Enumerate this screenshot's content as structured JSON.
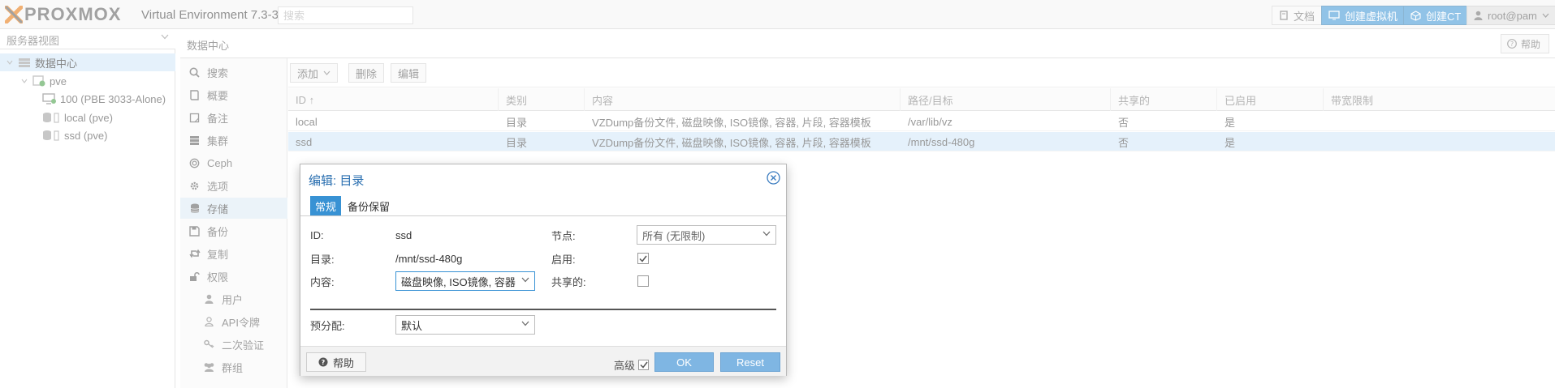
{
  "topbar": {
    "logo_text": "PROXMOX",
    "subtitle": "Virtual Environment 7.3-3",
    "search_placeholder": "搜索",
    "docs_label": "文档",
    "create_vm_label": "创建虚拟机",
    "create_ct_label": "创建CT",
    "user_label": "root@pam"
  },
  "tree": {
    "view_label": "服务器视图",
    "items": [
      {
        "label": "数据中心",
        "icon": "datacenter-icon"
      },
      {
        "label": "pve",
        "icon": "node-icon"
      },
      {
        "label": "100 (PBE 3033-Alone)",
        "icon": "vm-icon"
      },
      {
        "label": "local (pve)",
        "icon": "storage-icon"
      },
      {
        "label": "ssd (pve)",
        "icon": "storage-icon"
      }
    ]
  },
  "main": {
    "title": "数据中心",
    "help_label": "帮助"
  },
  "menu": {
    "items": [
      {
        "label": "搜索",
        "icon": "search-icon"
      },
      {
        "label": "概要",
        "icon": "book-icon"
      },
      {
        "label": "备注",
        "icon": "note-icon"
      },
      {
        "label": "集群",
        "icon": "server-icon"
      },
      {
        "label": "Ceph",
        "icon": "ceph-icon"
      },
      {
        "label": "选项",
        "icon": "gear-icon"
      },
      {
        "label": "存储",
        "icon": "database-icon"
      },
      {
        "label": "备份",
        "icon": "floppy-icon"
      },
      {
        "label": "复制",
        "icon": "retweet-icon"
      },
      {
        "label": "权限",
        "icon": "unlock-icon"
      },
      {
        "label": "用户",
        "icon": "user-icon"
      },
      {
        "label": "API令牌",
        "icon": "user-o-icon"
      },
      {
        "label": "二次验证",
        "icon": "key-icon"
      },
      {
        "label": "群组",
        "icon": "users-icon"
      }
    ]
  },
  "toolbar": {
    "add_label": "添加",
    "delete_label": "删除",
    "edit_label": "编辑"
  },
  "table": {
    "columns": [
      "ID ↑",
      "类别",
      "内容",
      "路径/目标",
      "共享的",
      "已启用",
      "带宽限制"
    ],
    "rows": [
      [
        "local",
        "目录",
        "VZDump备份文件, 磁盘映像, ISO镜像, 容器, 片段, 容器模板",
        "/var/lib/vz",
        "否",
        "是",
        ""
      ],
      [
        "ssd",
        "目录",
        "VZDump备份文件, 磁盘映像, ISO镜像, 容器, 片段, 容器模板",
        "/mnt/ssd-480g",
        "否",
        "是",
        ""
      ]
    ]
  },
  "dialog": {
    "title": "编辑: 目录",
    "tabs": [
      "常规",
      "备份保留"
    ],
    "fields": {
      "id_label": "ID:",
      "id_value": "ssd",
      "dir_label": "目录:",
      "dir_value": "/mnt/ssd-480g",
      "content_label": "内容:",
      "content_value": "磁盘映像, ISO镜像, 容器",
      "node_label": "节点:",
      "node_value": "所有 (无限制)",
      "enable_label": "启用:",
      "enable_checked": true,
      "shared_label": "共享的:",
      "shared_checked": false,
      "prealloc_label": "预分配:",
      "prealloc_value": "默认"
    },
    "footer": {
      "help_label": "帮助",
      "advanced_label": "高级",
      "advanced_checked": true,
      "ok_label": "OK",
      "reset_label": "Reset"
    }
  },
  "colors": {
    "accent": "#3892d4",
    "logo_orange": "#e57000",
    "selection": "#cfe6f7"
  }
}
